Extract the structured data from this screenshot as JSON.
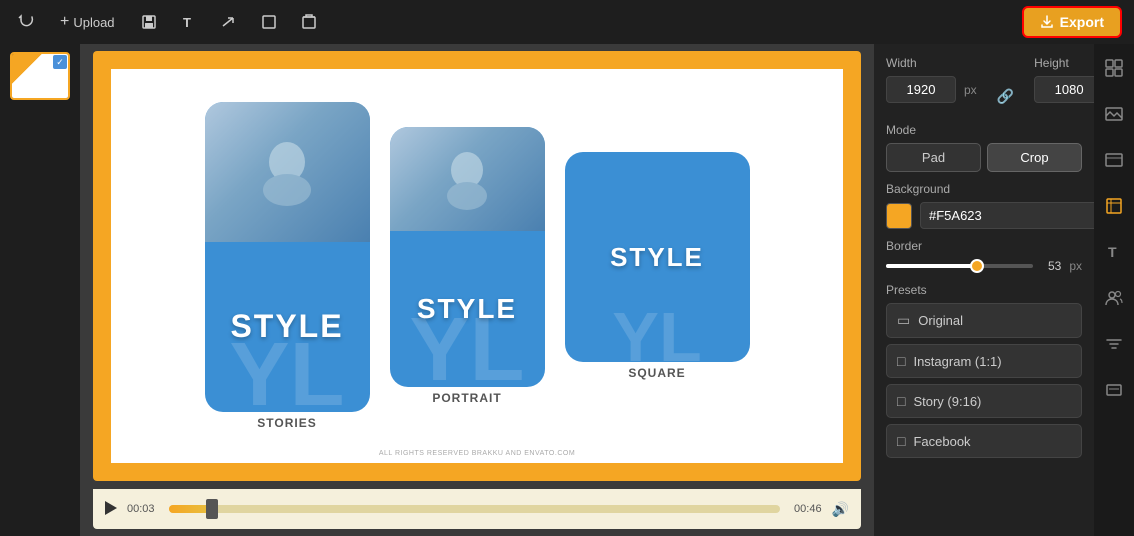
{
  "toolbar": {
    "upload_label": "Upload",
    "export_label": "Export"
  },
  "canvas": {
    "background_color": "#f5a623",
    "cards": [
      {
        "id": "stories",
        "style_text": "STYLE",
        "bg_text": "YL",
        "label": "STORIES"
      },
      {
        "id": "portrait",
        "style_text": "STYLE",
        "bg_text": "YL",
        "label": "PORTRAIT"
      },
      {
        "id": "square",
        "style_text": "STYLE",
        "bg_text": "YL",
        "label": "SQUARE"
      }
    ],
    "copyright": "ALL RIGHTS RESERVED BRAKKU AND ENVATO.COM"
  },
  "playback": {
    "current_time": "00:03",
    "end_time": "00:46"
  },
  "settings": {
    "width_label": "Width",
    "height_label": "Height",
    "width_value": "1920",
    "height_value": "1080",
    "px_unit": "px",
    "mode_label": "Mode",
    "pad_label": "Pad",
    "crop_label": "Crop",
    "background_label": "Background",
    "background_color": "#F5A623",
    "border_label": "Border",
    "border_value": "53",
    "border_unit": "px",
    "presets_label": "Presets",
    "presets": [
      {
        "id": "original",
        "label": "Original",
        "icon": "▭"
      },
      {
        "id": "instagram",
        "label": "Instagram (1:1)",
        "icon": "□"
      },
      {
        "id": "story",
        "label": "Story (9:16)",
        "icon": "□"
      },
      {
        "id": "facebook",
        "label": "Facebook",
        "icon": "□"
      }
    ]
  }
}
